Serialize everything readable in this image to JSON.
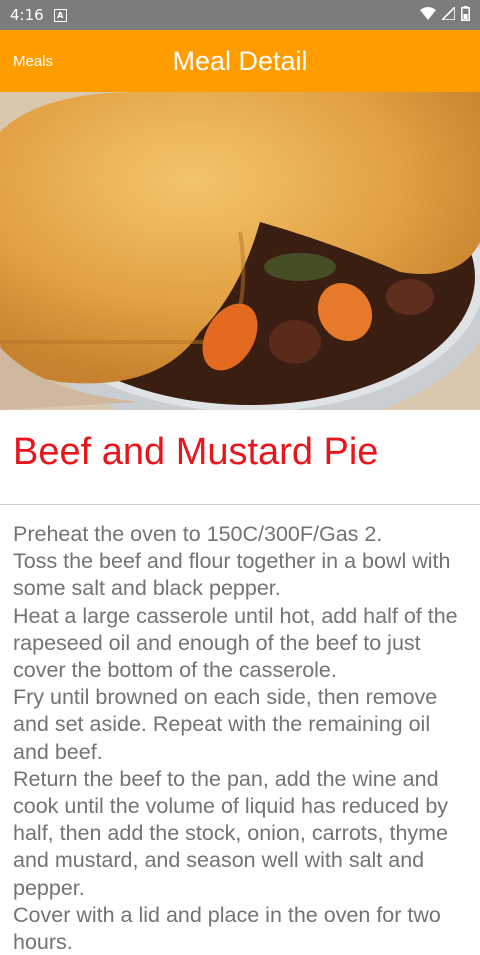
{
  "status_bar": {
    "time": "4:16",
    "notification_icon": "a-icon",
    "wifi_icon": "wifi-icon",
    "signal_icon": "signal-icon",
    "battery_icon": "battery-icon"
  },
  "app_bar": {
    "back_label": "Meals",
    "title": "Meal Detail",
    "color": "#ff9d00"
  },
  "meal": {
    "image_description": "meal-photo",
    "name": "Beef and Mustard Pie",
    "name_color": "#e8161b",
    "instructions": "Preheat the oven to 150C/300F/Gas 2.\nToss the beef and flour together in a bowl with some salt and black pepper.\nHeat a large casserole until hot, add half of the rapeseed oil and enough of the beef to just cover the bottom of the casserole.\nFry until browned on each side, then remove and set aside. Repeat with the remaining oil and beef.\nReturn the beef to the pan, add the wine and cook until the volume of liquid has reduced by half, then add the stock, onion, carrots, thyme and mustard, and season well with salt and pepper.\nCover with a lid and place in the oven for two hours.\nRemove from the oven, check the seasoning"
  }
}
